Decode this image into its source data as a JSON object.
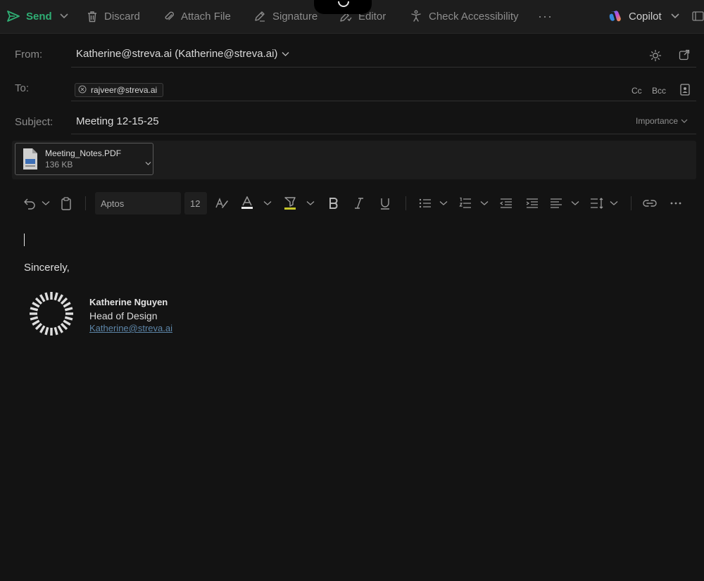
{
  "toolbar": {
    "send": "Send",
    "discard": "Discard",
    "attach_file": "Attach File",
    "signature": "Signature",
    "editor": "Editor",
    "check_accessibility": "Check Accessibility",
    "more": "···",
    "copilot": "Copilot"
  },
  "header": {
    "from_label": "From:",
    "from_value": "Katherine@streva.ai (Katherine@streva.ai)",
    "to_label": "To:",
    "to_recipient": "rajveer@streva.ai",
    "cc": "Cc",
    "bcc": "Bcc",
    "subject_label": "Subject:",
    "subject_value": "Meeting 12-15-25",
    "importance": "Importance"
  },
  "attachment": {
    "name": "Meeting_Notes.PDF",
    "size": "136 KB"
  },
  "format_bar": {
    "font": "Aptos",
    "size": "12"
  },
  "body": {
    "closing": "Sincerely,",
    "signature_name": "Katherine Nguyen",
    "signature_title": "Head of Design",
    "signature_email": "Katherine@streva.ai"
  },
  "colors": {
    "accent_send": "#2fae74",
    "background": "#131313",
    "toolbar": "#1d1d1d",
    "link": "#5d86a9"
  },
  "icons": [
    "send-icon",
    "trash-icon",
    "paperclip-icon",
    "pen-icon",
    "editor-icon",
    "accessibility-icon",
    "copilot-icon",
    "sun-icon",
    "popout-icon",
    "contact-book-icon",
    "pdf-file-icon",
    "undo-icon",
    "clipboard-icon",
    "format-painter-icon",
    "font-color-icon",
    "highlighter-icon",
    "bold-icon",
    "italic-icon",
    "underline-icon",
    "bullets-icon",
    "numbering-icon",
    "indent-icon",
    "outdent-icon",
    "align-icon",
    "line-spacing-icon",
    "link-icon",
    "company-logo-icon"
  ]
}
